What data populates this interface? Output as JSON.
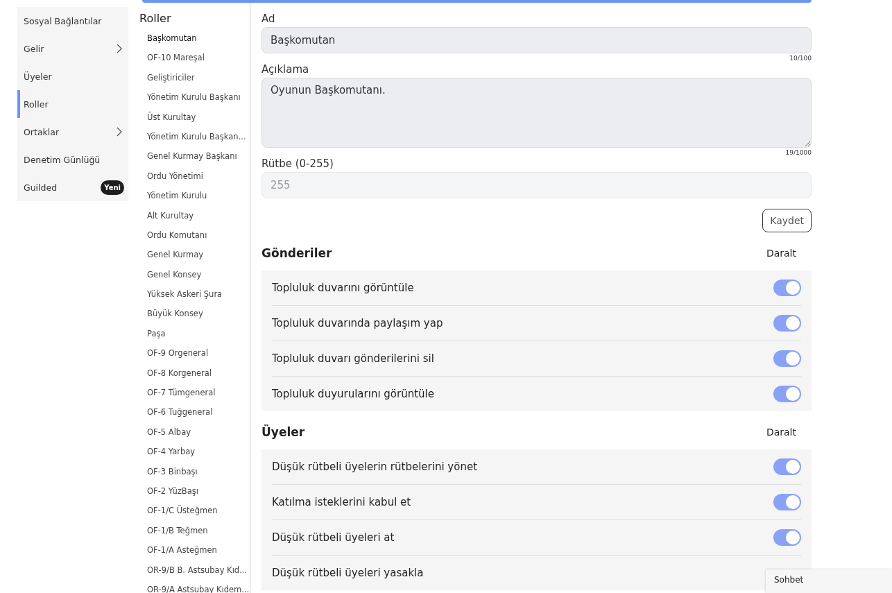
{
  "nav": {
    "items": [
      {
        "label": "Sosyal Bağlantılar",
        "selected": false,
        "submenu": false
      },
      {
        "label": "Gelir",
        "selected": false,
        "submenu": true
      },
      {
        "label": "Üyeler",
        "selected": false,
        "submenu": false
      },
      {
        "label": "Roller",
        "selected": true,
        "submenu": false
      },
      {
        "label": "Ortaklar",
        "selected": false,
        "submenu": true
      },
      {
        "label": "Denetim Günlüğü",
        "selected": false,
        "submenu": false
      },
      {
        "label": "Guilded",
        "selected": false,
        "submenu": false,
        "badge": "Yeni"
      }
    ]
  },
  "roles": {
    "title": "Roller",
    "items": [
      {
        "label": "Başkomutan",
        "selected": true
      },
      {
        "label": "OF-10 Mareşal",
        "selected": false
      },
      {
        "label": "Geliştiriciler",
        "selected": false
      },
      {
        "label": "Yönetim Kurulu Başkanı",
        "selected": false
      },
      {
        "label": "Üst Kurultay",
        "selected": false
      },
      {
        "label": "Yönetim Kurulu Başkan...",
        "selected": false
      },
      {
        "label": "Genel Kurmay Başkanı",
        "selected": false
      },
      {
        "label": "Ordu Yönetimi",
        "selected": false
      },
      {
        "label": "Yönetim Kurulu",
        "selected": false
      },
      {
        "label": "Alt Kurultay",
        "selected": false
      },
      {
        "label": "Ordu Komutanı",
        "selected": false
      },
      {
        "label": "Genel Kurmay",
        "selected": false
      },
      {
        "label": "Genel Konsey",
        "selected": false
      },
      {
        "label": "Yüksek Askeri Şura",
        "selected": false
      },
      {
        "label": "Büyük Konsey",
        "selected": false
      },
      {
        "label": "Paşa",
        "selected": false
      },
      {
        "label": "OF-9 Orgeneral",
        "selected": false
      },
      {
        "label": "OF-8 Korgeneral",
        "selected": false
      },
      {
        "label": "OF-7 Tümgeneral",
        "selected": false
      },
      {
        "label": "OF-6 Tuğgeneral",
        "selected": false
      },
      {
        "label": "OF-5 Albay",
        "selected": false
      },
      {
        "label": "OF-4 Yarbay",
        "selected": false
      },
      {
        "label": "OF-3 Binbaşı",
        "selected": false
      },
      {
        "label": "OF-2 YüzBaşı",
        "selected": false
      },
      {
        "label": "OF-1/C Üsteğmen",
        "selected": false
      },
      {
        "label": "OF-1/B Teğmen",
        "selected": false
      },
      {
        "label": "OF-1/A Asteğmen",
        "selected": false
      },
      {
        "label": "OR-9/B B. Astsubay Kıd...",
        "selected": false
      },
      {
        "label": "OR-9/A Astsubay Kıdem...",
        "selected": false
      }
    ]
  },
  "form": {
    "name": {
      "label": "Ad",
      "value": "Başkomutan",
      "counter": "10/100"
    },
    "description": {
      "label": "Açıklama",
      "value": "Oyunun Başkomutanı.",
      "counter": "19/1000"
    },
    "rank": {
      "label": "Rütbe (0-255)",
      "placeholder": "255"
    },
    "save_button": "Kaydet"
  },
  "sections": [
    {
      "title": "Gönderiler",
      "collapse": "Daralt",
      "permissions": [
        {
          "label": "Topluluk duvarını görüntüle",
          "on": true
        },
        {
          "label": "Topluluk duvarında paylaşım yap",
          "on": true
        },
        {
          "label": "Topluluk duvarı gönderilerini sil",
          "on": true
        },
        {
          "label": "Topluluk duyurularını görüntüle",
          "on": true
        }
      ]
    },
    {
      "title": "Üyeler",
      "collapse": "Daralt",
      "permissions": [
        {
          "label": "Düşük rütbeli üyelerin rütbelerini yönet",
          "on": true
        },
        {
          "label": "Katılma isteklerini kabul et",
          "on": true
        },
        {
          "label": "Düşük rütbeli üyeleri at",
          "on": true
        },
        {
          "label": "Düşük rütbeli üyeleri yasakla"
        }
      ]
    }
  ],
  "chat": {
    "label": "Sohbet"
  }
}
